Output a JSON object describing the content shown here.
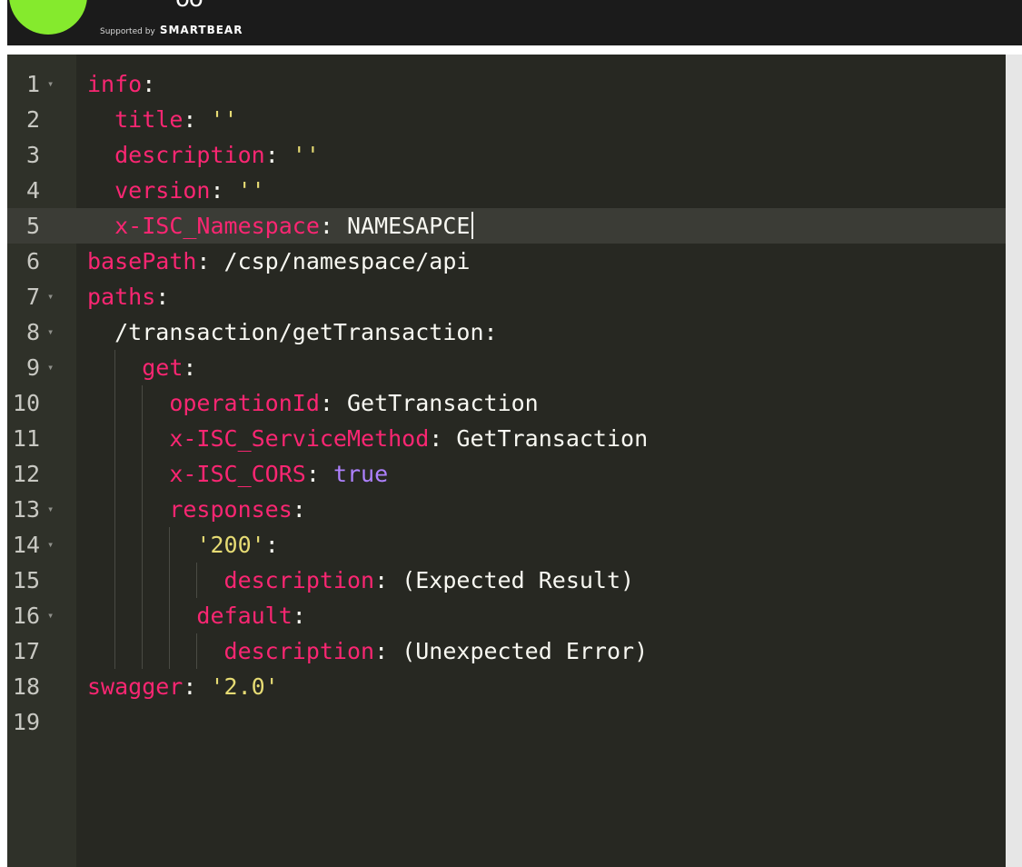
{
  "header": {
    "supported_small": "Supported by",
    "supported_brand": "SMARTBEAR"
  },
  "editor": {
    "lines": [
      {
        "num": "1",
        "fold": "▾",
        "segments": [
          {
            "t": "info",
            "c": "k"
          },
          {
            "t": ":",
            "c": "p"
          }
        ]
      },
      {
        "num": "2",
        "fold": "",
        "segments": [
          {
            "t": "  ",
            "c": "p"
          },
          {
            "t": "title",
            "c": "k"
          },
          {
            "t": ": ",
            "c": "p"
          },
          {
            "t": "''",
            "c": "v"
          }
        ]
      },
      {
        "num": "3",
        "fold": "",
        "segments": [
          {
            "t": "  ",
            "c": "p"
          },
          {
            "t": "description",
            "c": "k"
          },
          {
            "t": ": ",
            "c": "p"
          },
          {
            "t": "''",
            "c": "v"
          }
        ]
      },
      {
        "num": "4",
        "fold": "",
        "segments": [
          {
            "t": "  ",
            "c": "p"
          },
          {
            "t": "version",
            "c": "k"
          },
          {
            "t": ": ",
            "c": "p"
          },
          {
            "t": "''",
            "c": "v"
          }
        ]
      },
      {
        "num": "5",
        "fold": "",
        "active": true,
        "segments": [
          {
            "t": "  ",
            "c": "p"
          },
          {
            "t": "x-ISC_Namespace",
            "c": "k"
          },
          {
            "t": ": ",
            "c": "p"
          },
          {
            "t": "NAMESAPCE",
            "c": "t"
          }
        ]
      },
      {
        "num": "6",
        "fold": "",
        "segments": [
          {
            "t": "basePath",
            "c": "k"
          },
          {
            "t": ": ",
            "c": "p"
          },
          {
            "t": "/csp/namespace/api",
            "c": "t"
          }
        ]
      },
      {
        "num": "7",
        "fold": "▾",
        "segments": [
          {
            "t": "paths",
            "c": "k"
          },
          {
            "t": ":",
            "c": "p"
          }
        ]
      },
      {
        "num": "8",
        "fold": "▾",
        "segments": [
          {
            "t": "  ",
            "c": "p"
          },
          {
            "t": "/transaction/getTransaction",
            "c": "t"
          },
          {
            "t": ":",
            "c": "p"
          }
        ]
      },
      {
        "num": "9",
        "fold": "▾",
        "segments": [
          {
            "t": "    ",
            "c": "p"
          },
          {
            "t": "get",
            "c": "k"
          },
          {
            "t": ":",
            "c": "p"
          }
        ]
      },
      {
        "num": "10",
        "fold": "",
        "segments": [
          {
            "t": "      ",
            "c": "p"
          },
          {
            "t": "operationId",
            "c": "k"
          },
          {
            "t": ": ",
            "c": "p"
          },
          {
            "t": "GetTransaction",
            "c": "t"
          }
        ]
      },
      {
        "num": "11",
        "fold": "",
        "segments": [
          {
            "t": "      ",
            "c": "p"
          },
          {
            "t": "x-ISC_ServiceMethod",
            "c": "k"
          },
          {
            "t": ": ",
            "c": "p"
          },
          {
            "t": "GetTransaction",
            "c": "t"
          }
        ]
      },
      {
        "num": "12",
        "fold": "",
        "segments": [
          {
            "t": "      ",
            "c": "p"
          },
          {
            "t": "x-ISC_CORS",
            "c": "k"
          },
          {
            "t": ": ",
            "c": "p"
          },
          {
            "t": "true",
            "c": "b"
          }
        ]
      },
      {
        "num": "13",
        "fold": "▾",
        "segments": [
          {
            "t": "      ",
            "c": "p"
          },
          {
            "t": "responses",
            "c": "k"
          },
          {
            "t": ":",
            "c": "p"
          }
        ]
      },
      {
        "num": "14",
        "fold": "▾",
        "segments": [
          {
            "t": "        ",
            "c": "p"
          },
          {
            "t": "'200'",
            "c": "v"
          },
          {
            "t": ":",
            "c": "p"
          }
        ]
      },
      {
        "num": "15",
        "fold": "",
        "segments": [
          {
            "t": "          ",
            "c": "p"
          },
          {
            "t": "description",
            "c": "k"
          },
          {
            "t": ": ",
            "c": "p"
          },
          {
            "t": "(Expected Result)",
            "c": "t"
          }
        ]
      },
      {
        "num": "16",
        "fold": "▾",
        "segments": [
          {
            "t": "        ",
            "c": "p"
          },
          {
            "t": "default",
            "c": "k"
          },
          {
            "t": ":",
            "c": "p"
          }
        ]
      },
      {
        "num": "17",
        "fold": "",
        "segments": [
          {
            "t": "          ",
            "c": "p"
          },
          {
            "t": "description",
            "c": "k"
          },
          {
            "t": ": ",
            "c": "p"
          },
          {
            "t": "(Unexpected Error)",
            "c": "t"
          }
        ]
      },
      {
        "num": "18",
        "fold": "",
        "segments": [
          {
            "t": "swagger",
            "c": "k"
          },
          {
            "t": ": ",
            "c": "p"
          },
          {
            "t": "'2.0'",
            "c": "v"
          }
        ]
      },
      {
        "num": "19",
        "fold": "",
        "segments": []
      }
    ]
  },
  "colors": {
    "editor_bg": "#272822",
    "key": "#f92672",
    "string": "#e6db74",
    "boolean": "#ae81ff",
    "logo_green": "#85ea2d"
  },
  "icons": {
    "fold": "fold-arrow-icon",
    "logo": "swagger-logo-icon"
  }
}
